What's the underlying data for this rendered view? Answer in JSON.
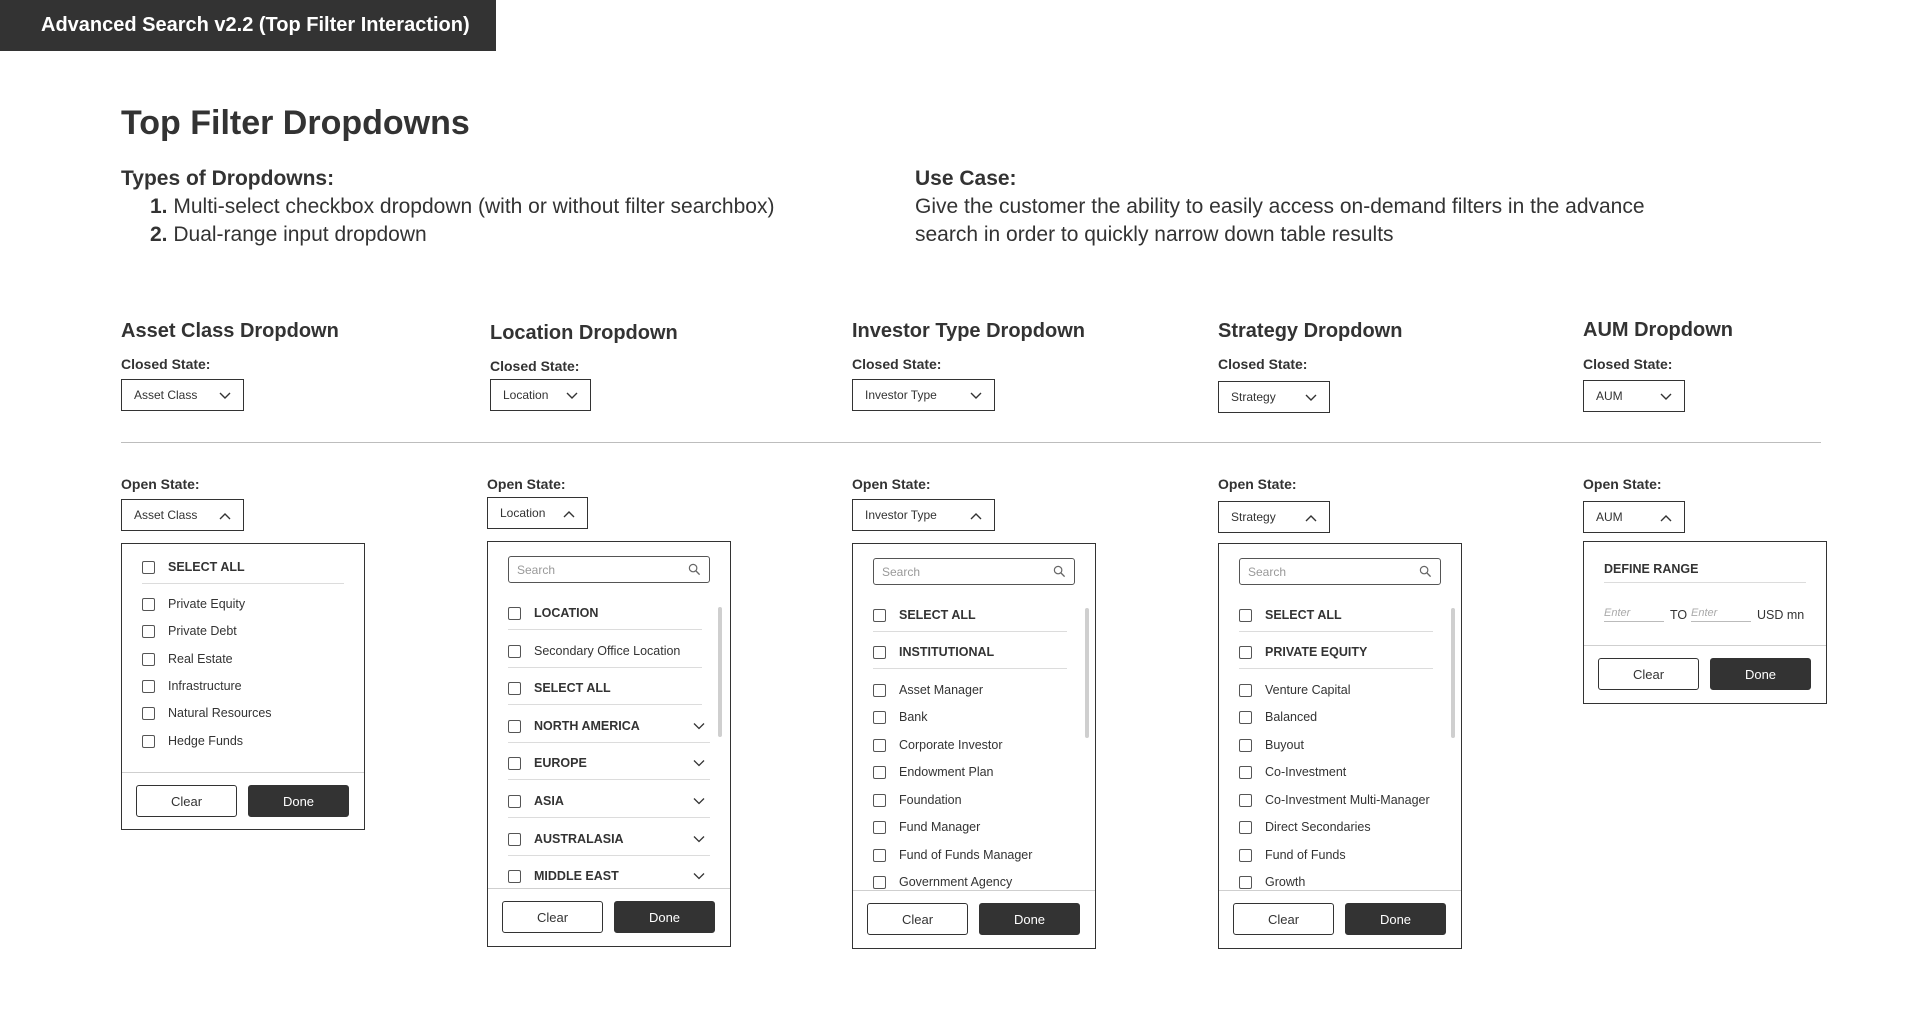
{
  "header": {
    "title": "Advanced Search v2.2  (Top Filter Interaction)"
  },
  "page_title": "Top Filter Dropdowns",
  "types": {
    "heading": "Types of Dropdowns:",
    "items": [
      {
        "num": "1.",
        "text": "Multi-select checkbox dropdown (with or without filter searchbox)"
      },
      {
        "num": "2.",
        "text": "Dual-range input dropdown"
      }
    ]
  },
  "use_case": {
    "heading": "Use Case:",
    "text": "Give the customer the ability to easily access on-demand filters in the advance search in order to quickly narrow down table results"
  },
  "labels": {
    "closed": "Closed State:",
    "open": "Open State:",
    "clear": "Clear",
    "done": "Done",
    "search": "Search"
  },
  "asset": {
    "title": "Asset Class Dropdown",
    "select": "Asset Class",
    "select_all": "SELECT ALL",
    "items": [
      "Private Equity",
      "Private Debt",
      "Real Estate",
      "Infrastructure",
      "Natural Resources",
      "Hedge Funds"
    ]
  },
  "location": {
    "title": "Location Dropdown",
    "select": "Location",
    "items": [
      "LOCATION",
      "Secondary Office Location",
      "SELECT ALL",
      "NORTH AMERICA",
      "EUROPE",
      "ASIA",
      "AUSTRALASIA",
      "MIDDLE EAST"
    ]
  },
  "investor": {
    "title": "Investor Type Dropdown",
    "select": "Investor Type",
    "select_all": "SELECT ALL",
    "group": "INSTITUTIONAL",
    "items": [
      "Asset Manager",
      "Bank",
      "Corporate Investor",
      "Endowment Plan",
      "Foundation",
      "Fund Manager",
      "Fund of Funds Manager",
      "Government Agency"
    ]
  },
  "strategy": {
    "title": "Strategy Dropdown",
    "select": "Strategy",
    "select_all": "SELECT ALL",
    "group": "PRIVATE EQUITY",
    "items": [
      "Venture Capital",
      "Balanced",
      "Buyout",
      "Co-Investment",
      "Co-Investment Multi-Manager",
      "Direct Secondaries",
      "Fund of Funds",
      "Growth"
    ]
  },
  "aum": {
    "title": "AUM Dropdown",
    "select": "AUM",
    "define_range": "DEFINE RANGE",
    "enter": "Enter",
    "to": "TO",
    "unit": "USD mn"
  }
}
